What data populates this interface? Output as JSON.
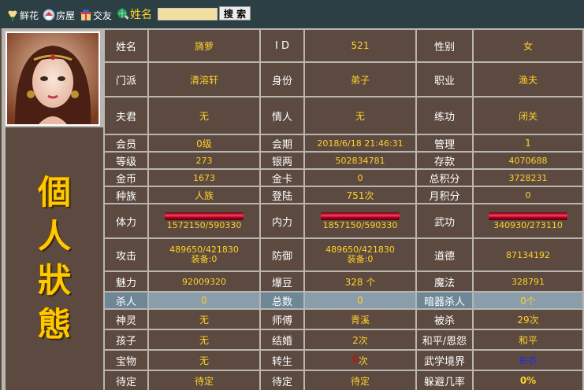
{
  "nav": {
    "flower": "鲜花",
    "house": "房屋",
    "friends": "交友",
    "name": "姓名"
  },
  "search": {
    "button": "搜 索",
    "value": ""
  },
  "status_title": [
    "個",
    "人",
    "狀",
    "態"
  ],
  "profile": {
    "name_label": "姓名",
    "name": "旖萝",
    "id_label": "I D",
    "id": "521",
    "gender_label": "性别",
    "gender": "女",
    "sect_label": "门派",
    "sect": "清溶轩",
    "identity_label": "身份",
    "identity": "弟子",
    "job_label": "职业",
    "job": "渔夫",
    "husband_label": "夫君",
    "husband": "无",
    "lover_label": "情人",
    "lover": "无",
    "training_label": "练功",
    "training": "闭关"
  },
  "rows": [
    [
      "会员",
      "0级",
      "会期",
      "2018/6/18 21:46:31",
      "管理",
      "1"
    ],
    [
      "等级",
      "273",
      "银两",
      "502834781",
      "存款",
      "4070688"
    ],
    [
      "金币",
      "1673",
      "金卡",
      "0",
      "总积分",
      "3728231"
    ],
    [
      "种族",
      "人族",
      "登陆",
      "751次",
      "月积分",
      "0"
    ],
    [
      "体力",
      "1572150/590330",
      "内力",
      "1857150/590330",
      "武功",
      "340930/273110"
    ],
    [
      "攻击",
      "489650/421830",
      "防御",
      "489650/421830",
      "道德",
      "87134192"
    ],
    [
      "魅力",
      "92009320",
      "爆豆",
      "328 个",
      "魔法",
      "328791"
    ],
    [
      "杀人",
      "0",
      "总数",
      "0",
      "暗器杀人",
      "0个"
    ],
    [
      "神灵",
      "无",
      "师傅",
      "青溪",
      "被杀",
      "29次"
    ],
    [
      "孩子",
      "无",
      "结婚",
      "2次",
      "和平/恩怨",
      "和平"
    ],
    [
      "宝物",
      "无",
      "转生",
      "0",
      "武学境界",
      "布衣"
    ],
    [
      "待定",
      "待定",
      "待定",
      "待定",
      "躲避几率",
      "0%"
    ]
  ],
  "equip_atk": "装备:0",
  "equip_def": "装备:0",
  "rebirth_suffix": "次",
  "bars": {
    "hp_fill": 1,
    "mp_fill": 1,
    "skill_fill": 1
  },
  "colors": {
    "bar": "#e0203c",
    "label_bg": "#5c4a40",
    "value_text": "#ffd02a",
    "highlight_row": "#8a9daa"
  },
  "icons": {
    "flower": "flower-icon",
    "house": "house-icon",
    "friends": "gift-icon",
    "name": "globe-search-icon"
  }
}
